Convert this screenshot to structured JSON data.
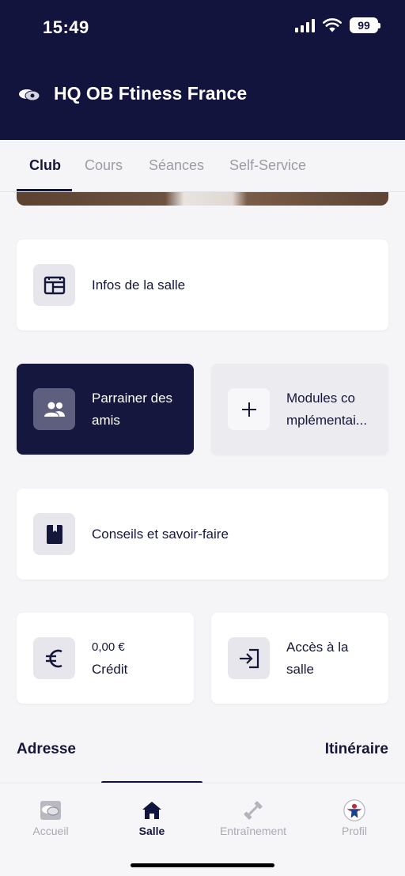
{
  "status_bar": {
    "time": "15:49",
    "battery": "99"
  },
  "header": {
    "club_name": "HQ OB Ftiness France"
  },
  "tabs": [
    {
      "label": "Club",
      "active": true
    },
    {
      "label": "Cours",
      "active": false
    },
    {
      "label": "Séances",
      "active": false
    },
    {
      "label": "Self-Service",
      "active": false
    }
  ],
  "cards": {
    "infos": {
      "label": "Infos de la salle",
      "icon": "building-icon"
    },
    "referral": {
      "line1": "Parrainer des",
      "line2": "amis",
      "icon": "people-icon"
    },
    "modules": {
      "line1": "Modules co",
      "line2": "mplémentai...",
      "icon": "plus-icon"
    },
    "tips": {
      "label": "Conseils et savoir-faire",
      "icon": "book-icon"
    },
    "credit": {
      "amount": "0,00 €",
      "label": "Crédit",
      "icon": "euro-icon"
    },
    "access": {
      "line1": "Accès à la",
      "line2": "salle",
      "icon": "login-icon"
    }
  },
  "address": {
    "title": "Adresse",
    "itinerary": "Itinéraire"
  },
  "bottom_nav": [
    {
      "label": "Accueil",
      "icon": "club-logo-icon",
      "active": false
    },
    {
      "label": "Salle",
      "icon": "home-icon",
      "active": true
    },
    {
      "label": "Entraînement",
      "icon": "dumbbell-icon",
      "active": false
    },
    {
      "label": "Profil",
      "icon": "avatar-icon",
      "active": false
    }
  ],
  "colors": {
    "navy": "#13143d",
    "background": "#f5f5f7",
    "inactive": "#a9a9b4"
  }
}
